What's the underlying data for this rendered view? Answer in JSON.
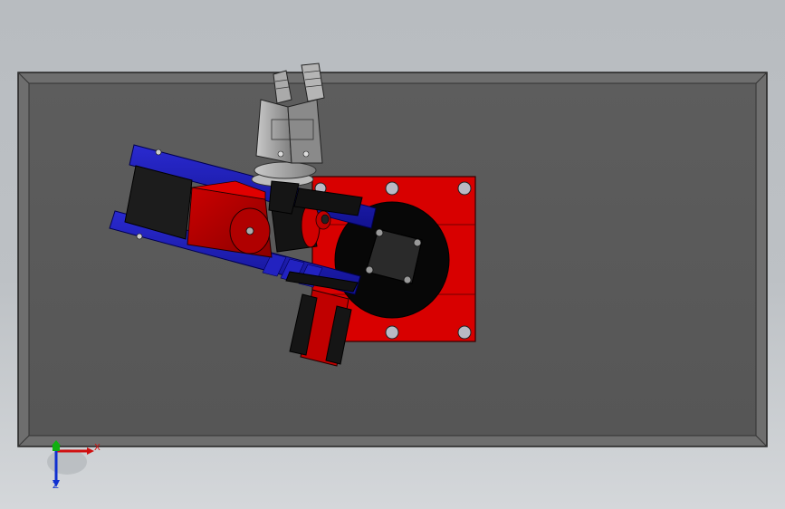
{
  "viewport": {
    "background_top": "#b8bcc0",
    "background_bottom": "#d4d7da"
  },
  "colors": {
    "table_frame": "#6a6a6a",
    "table_top": "#5b5b5b",
    "base_plate": "#d80000",
    "arm_link": "#1a1ab8",
    "arm_joint": "#bb0000",
    "motor": "#111111",
    "gripper": "#9a9a9a",
    "axis_x": "#d01010",
    "axis_y": "#10b010",
    "axis_z": "#1030d0"
  },
  "triad": {
    "x_label": "X",
    "z_label": "Z"
  },
  "model": {
    "parts": [
      "table",
      "base-plate",
      "turntable-motor",
      "shoulder-bracket",
      "upper-arm",
      "elbow-joint",
      "wrist",
      "gripper"
    ],
    "bolt_icon": "bolt-icon"
  }
}
